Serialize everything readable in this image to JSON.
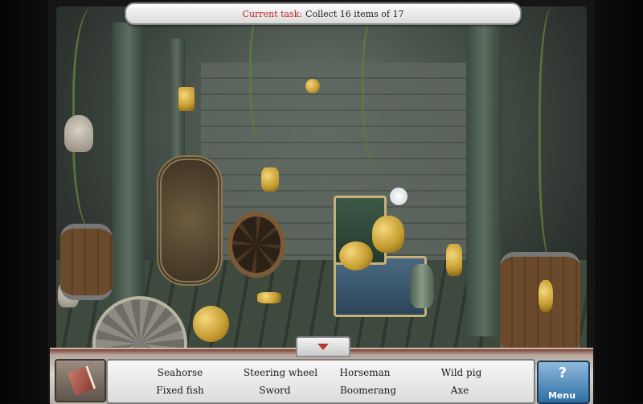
{
  "task": {
    "label": "Current task:",
    "text": "Collect 16 items of 17"
  },
  "items": [
    {
      "name": "Seahorse"
    },
    {
      "name": "Steering wheel"
    },
    {
      "name": "Horseman"
    },
    {
      "name": "Wild pig"
    },
    {
      "name": "Fixed fish"
    },
    {
      "name": "Sword"
    },
    {
      "name": "Boomerang"
    },
    {
      "name": "Axe"
    }
  ],
  "buttons": {
    "journal_icon": "journal-icon",
    "menu_label": "Menu",
    "hint_icon": "question-icon"
  },
  "colors": {
    "task_label": "#c0282c",
    "menu_button": "#2d6ea3",
    "frame_accent": "#7d3a34"
  }
}
